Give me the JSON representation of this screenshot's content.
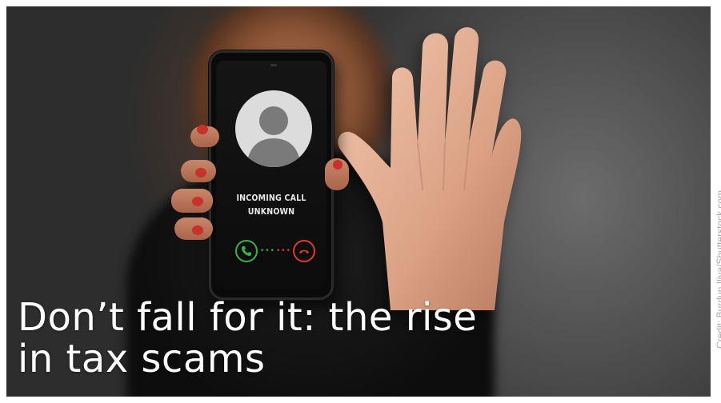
{
  "phone": {
    "call_title": "INCOMING CALL",
    "call_subtitle": "UNKNOWN",
    "accept_color": "#35b24a",
    "decline_color": "#e03a2f",
    "icons": [
      "person-silhouette-icon",
      "phone-accept-icon",
      "phone-decline-icon"
    ]
  },
  "headline": {
    "line1": "Don’t fall for it: the rise",
    "line2": "in tax scams"
  },
  "credit": "Credit: Burdun Iliya/Shutterstock.com"
}
